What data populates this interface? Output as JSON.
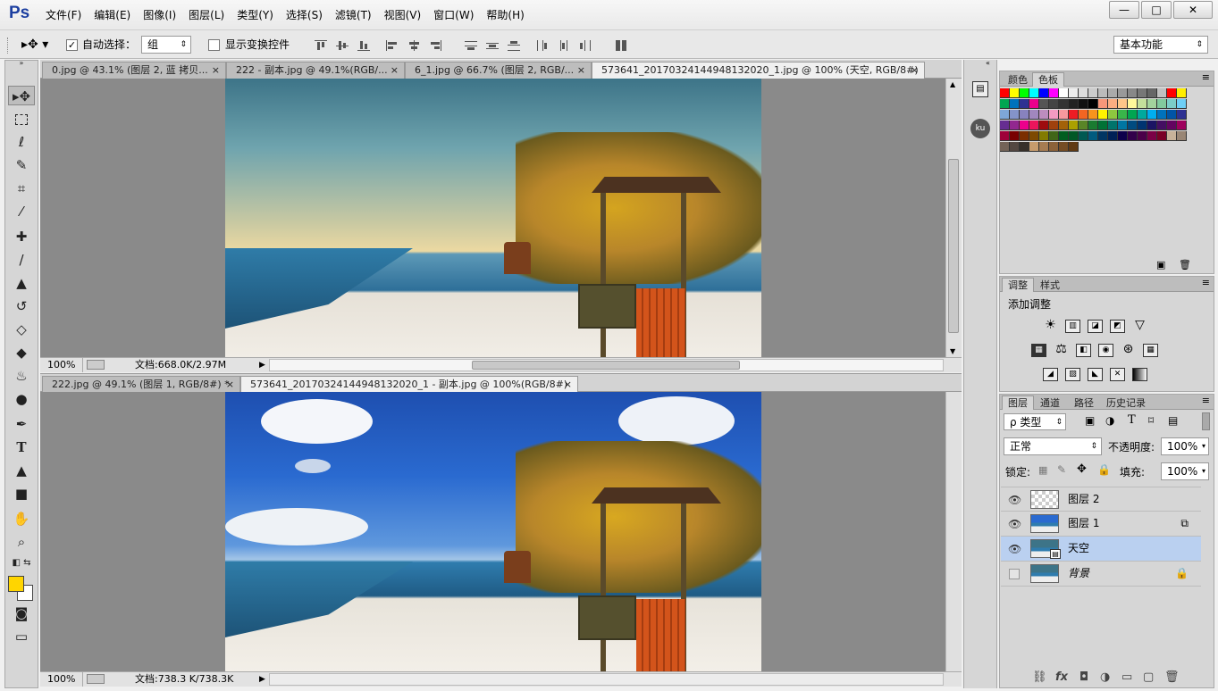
{
  "app": {
    "logo": "Ps"
  },
  "menu": [
    "文件(F)",
    "编辑(E)",
    "图像(I)",
    "图层(L)",
    "类型(Y)",
    "选择(S)",
    "滤镜(T)",
    "视图(V)",
    "窗口(W)",
    "帮助(H)"
  ],
  "window_controls": {
    "minimize": "—",
    "restore": "□",
    "close": "✕"
  },
  "options": {
    "auto_select_label": "自动选择：",
    "auto_select_checked": "✓",
    "auto_select_mode": "组",
    "show_transform_label": "显示变换控件",
    "workspace": "基本功能"
  },
  "doc1": {
    "tabs": [
      {
        "label": "0.jpg @ 43.1% (图层 2, 蓝 拷贝..."
      },
      {
        "label": "222 - 副本.jpg @ 49.1%(RGB/..."
      },
      {
        "label": "6_1.jpg @ 66.7% (图层 2, RGB/..."
      },
      {
        "label": "573641_20170324144948132020_1.jpg @ 100% (天空, RGB/8#)"
      }
    ],
    "close_glyph": "×",
    "zoom": "100%",
    "info": "文档:668.0K/2.97M"
  },
  "doc2": {
    "tabs": [
      {
        "label": "222.jpg @ 49.1% (图层 1, RGB/8#) *"
      },
      {
        "label": "573641_20170324144948132020_1 - 副本.jpg @ 100%(RGB/8#)"
      }
    ],
    "close_glyph": "×",
    "zoom": "100%",
    "info": "文档:738.3 K/738.3K"
  },
  "dock": {
    "ku_label": "ku"
  },
  "swatches_panel": {
    "tabs": [
      "颜色",
      "色板"
    ]
  },
  "adjustments_panel": {
    "tabs": [
      "调整",
      "样式"
    ],
    "title": "添加调整"
  },
  "layers_panel": {
    "tabs": [
      "图层",
      "通道",
      "路径",
      "历史记录"
    ],
    "filter_label": "ρ 类型",
    "blend_mode": "正常",
    "opacity_label": "不透明度:",
    "opacity_value": "100%",
    "lock_label": "锁定:",
    "fill_label": "填充:",
    "fill_value": "100%",
    "layers": [
      {
        "name": "图层 2",
        "visible": true,
        "selected": false
      },
      {
        "name": "图层 1",
        "visible": true,
        "selected": false
      },
      {
        "name": "天空",
        "visible": true,
        "selected": true
      },
      {
        "name": "背景",
        "visible": false,
        "selected": false
      }
    ],
    "bottom_icons": [
      "⛓",
      "fx",
      "◘",
      "◑",
      "▭",
      "▢",
      "🗑"
    ]
  },
  "colors": {
    "foreground": "#ffd500",
    "background": "#ffffff",
    "accent": "#1c3fa0"
  }
}
